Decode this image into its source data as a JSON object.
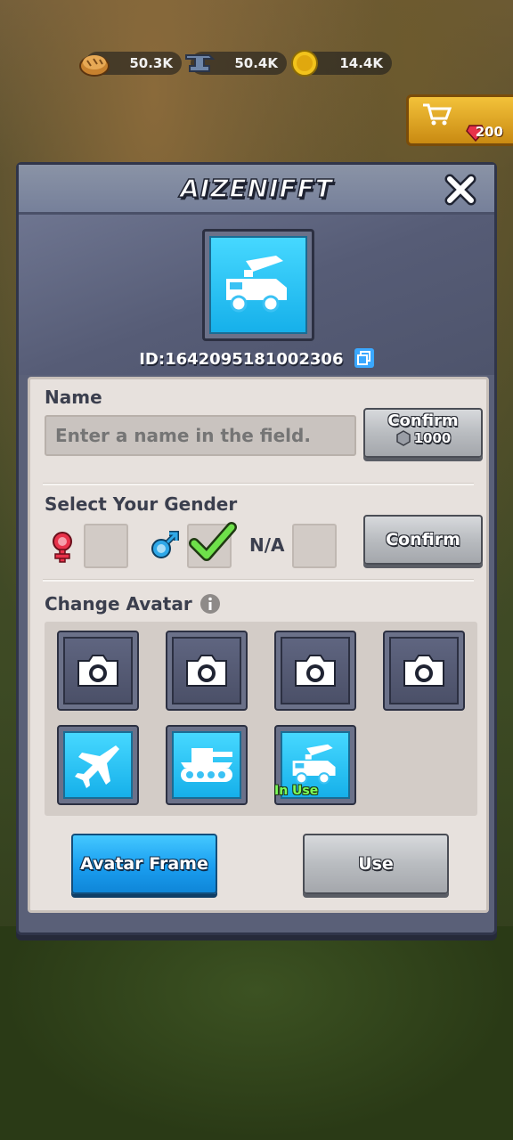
{
  "resources": [
    {
      "name": "food",
      "value": "50.3K",
      "icon": "bread-icon"
    },
    {
      "name": "iron",
      "value": "50.4K",
      "icon": "anvil-icon"
    },
    {
      "name": "gold",
      "value": "14.4K",
      "icon": "coin-icon"
    }
  ],
  "shop": {
    "gems": "200",
    "icon": "cart-icon"
  },
  "profile": {
    "title": "AIZENIFFT",
    "player_id": "ID:1642095181002306",
    "avatar_icon": "rocket-truck-icon"
  },
  "name_section": {
    "label": "Name",
    "placeholder": "Enter a name in the field.",
    "confirm_label": "Confirm",
    "cost": "1000"
  },
  "gender_section": {
    "label": "Select Your Gender",
    "options": [
      {
        "name": "female",
        "icon": "female-icon",
        "selected": false
      },
      {
        "name": "male",
        "icon": "male-icon",
        "selected": true
      },
      {
        "name": "na",
        "label": "N/A",
        "selected": false
      }
    ],
    "confirm_label": "Confirm"
  },
  "avatar_section": {
    "label": "Change Avatar",
    "slots": [
      {
        "type": "camera",
        "icon": "camera-icon"
      },
      {
        "type": "camera",
        "icon": "camera-icon"
      },
      {
        "type": "camera",
        "icon": "camera-icon"
      },
      {
        "type": "camera",
        "icon": "camera-icon"
      },
      {
        "type": "preset",
        "icon": "airplane-icon"
      },
      {
        "type": "preset",
        "icon": "tank-icon"
      },
      {
        "type": "preset",
        "icon": "rocket-truck-icon",
        "status": "In Use"
      }
    ]
  },
  "buttons": {
    "avatar_frame": "Avatar Frame",
    "use": "Use"
  },
  "colors": {
    "accent_blue": "#1a9ef0",
    "in_use_green": "#7dff5a",
    "panel_bg": "#e7e1dd",
    "modal_bg": "#5a6078"
  }
}
